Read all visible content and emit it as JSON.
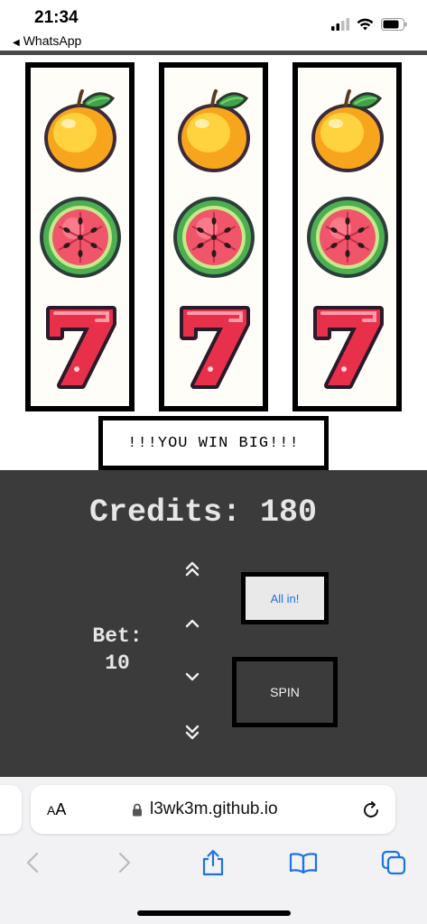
{
  "status_bar": {
    "time": "21:34",
    "back_app": "WhatsApp"
  },
  "reels": [
    {
      "symbols": [
        "lemon",
        "watermelon",
        "seven"
      ]
    },
    {
      "symbols": [
        "lemon",
        "watermelon",
        "seven"
      ]
    },
    {
      "symbols": [
        "lemon",
        "watermelon",
        "seven"
      ]
    }
  ],
  "message": "!!!YOU WIN BIG!!!",
  "credits_text": "Credits: 180",
  "bet": {
    "label": "Bet:",
    "value": "10"
  },
  "buttons": {
    "all_in": "All in!",
    "spin": "SPIN"
  },
  "bet_controls": [
    "double-chevron-up-icon",
    "chevron-up-icon",
    "chevron-down-icon",
    "double-chevron-down-icon"
  ],
  "browser": {
    "aa_label_small": "A",
    "aa_label_large": "A",
    "url": "l3wk3m.github.io"
  },
  "colors": {
    "panel": "#3b3b3b",
    "accent_link": "#1a73e8",
    "browser_icons": "#1a73e8"
  }
}
